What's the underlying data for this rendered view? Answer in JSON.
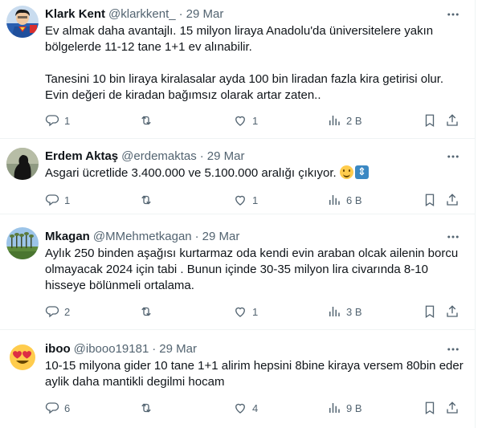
{
  "tweets": [
    {
      "name": "Klark Kent",
      "handle": "@klarkkent_",
      "separator": "·",
      "date": "29 Mar",
      "text": "Ev almak daha avantajlı.  15 milyon liraya Anadolu'da üniversitelere yakın bölgelerde 11-12 tane 1+1 ev alınabilir.\n\nTanesini 10 bin liraya kiralasalar ayda 100 bin liradan fazla kira getirisi olur. Evin değeri de kiradan bağımsız olarak artar zaten..",
      "replies": "1",
      "retweets": "",
      "likes": "1",
      "views": "2 B",
      "avatar_icon": "superman-avatar"
    },
    {
      "name": "Erdem Aktaş",
      "handle": "@erdemaktas",
      "separator": "·",
      "date": "29 Mar",
      "text": "Asgari ücretlide 3.400.000 ve 5.100.000 aralığı çıkıyor.",
      "replies": "1",
      "retweets": "",
      "likes": "1",
      "views": "6 B",
      "avatar_icon": "silhouette-avatar"
    },
    {
      "name": "Mkagan",
      "handle": "@MMehmetkagan",
      "separator": "·",
      "date": "29 Mar",
      "text": "Aylık 250 binden aşağısı kurtarmaz oda kendi evin araban olcak ailenin borcu olmayacak 2024 için tabi . Bunun içinde 30-35 milyon lira civarında 8-10 hisseye bölünmeli ortalama.",
      "replies": "2",
      "retweets": "",
      "likes": "1",
      "views": "3 B",
      "avatar_icon": "landscape-avatar"
    },
    {
      "name": "iboo",
      "handle": "@ibooo19181",
      "separator": "·",
      "date": "29 Mar",
      "text": "10-15 milyona gider 10 tane 1+1 alirim hepsini 8bine kiraya versem 80bin eder aylik daha mantikli degilmi hocam",
      "replies": "6",
      "retweets": "",
      "likes": "4",
      "views": "9 B",
      "avatar_icon": "heart-eyes-emoji-avatar"
    }
  ],
  "colors": {
    "text": "#0f1419",
    "secondary": "#536471",
    "divider": "#eff3f4"
  }
}
